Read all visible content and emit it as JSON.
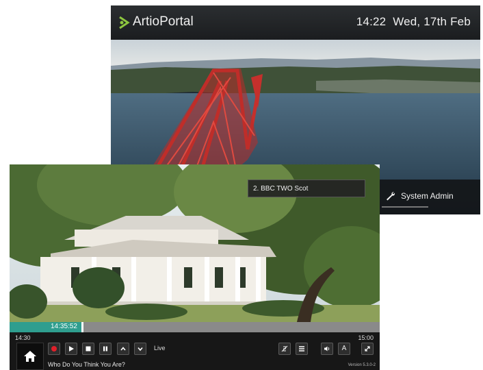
{
  "portal": {
    "brand": "ArtioPortal",
    "time": "14:22",
    "date": "Wed, 17th Feb",
    "admin_label": "System Admin",
    "accent": "#8dc63f"
  },
  "player": {
    "channel": "2. BBC TWO Scot",
    "current_time": "14:35:52",
    "start_time": "14:30",
    "end_time": "15:00",
    "progress": 0.195,
    "live_label": "Live",
    "programme_title": "Who Do You Think You Are?",
    "version": "Version 5.3.0-2",
    "accent": "#2f9e8f",
    "record_color": "#e0202a"
  }
}
